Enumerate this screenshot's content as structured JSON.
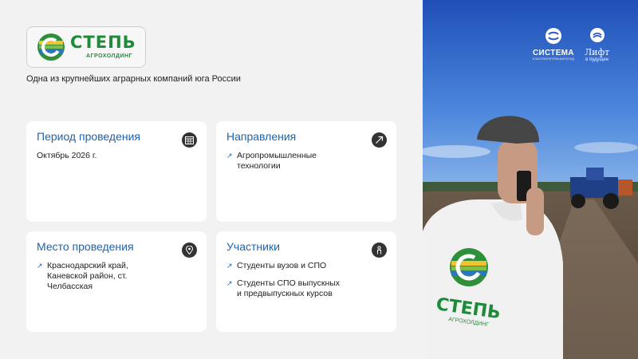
{
  "logo": {
    "wordmark": "СТЕПЬ",
    "subtitle": "АГРОХОЛДИНГ"
  },
  "tagline": "Одна из крупнейших аграрных компаний юга России",
  "cards": {
    "period": {
      "title": "Период проведения",
      "icon": "calendar-icon",
      "text": "Октябрь 2026 г."
    },
    "directions": {
      "title": "Направления",
      "icon": "compass-arrow-icon",
      "items": [
        "Агропромышленные технологии"
      ]
    },
    "location": {
      "title": "Место проведения",
      "icon": "location-pin-icon",
      "items": [
        "Краснодарский край, Каневской район, ст. Челбасская"
      ]
    },
    "participants": {
      "title": "Участники",
      "icon": "person-icon",
      "items": [
        "Студенты вузов и СПО",
        "Студенты СПО выпускных и предвыпускных курсов"
      ]
    }
  },
  "sponsors": {
    "sistema": {
      "name": "СИСТЕМА",
      "sub": "БЛАГОТВОРИТЕЛЬНЫЙ ФОНД"
    },
    "lift": {
      "name": "Лифт",
      "sub": "в будущее"
    }
  },
  "photo_shirt": {
    "wordmark": "СТЕПЬ",
    "subtitle": "АГРОХОЛДИНГ"
  },
  "colors": {
    "accent_blue": "#1d63b0",
    "brand_green": "#1f8a3a",
    "icon_dark": "#333333"
  }
}
